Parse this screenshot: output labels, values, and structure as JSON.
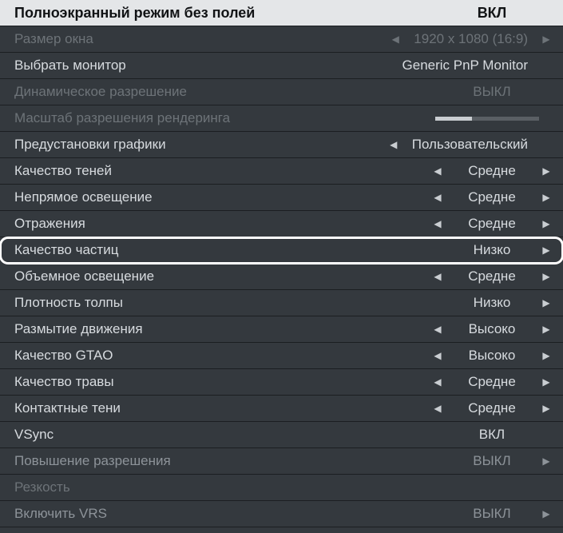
{
  "rows": [
    {
      "id": "borderless-fullscreen",
      "label": "Полноэкранный режим без полей",
      "value": "ВКЛ",
      "style": "header",
      "leftArrow": false,
      "rightArrow": false
    },
    {
      "id": "window-size",
      "label": "Размер окна",
      "value": "1920 x 1080 (16:9)",
      "style": "disabled",
      "leftArrow": true,
      "rightArrow": true
    },
    {
      "id": "select-monitor",
      "label": "Выбрать монитор",
      "value": "Generic PnP Monitor",
      "style": "normal",
      "leftArrow": false,
      "rightArrow": false
    },
    {
      "id": "dynamic-resolution",
      "label": "Динамическое разрешение",
      "value": "ВЫКЛ",
      "style": "disabled",
      "leftArrow": false,
      "rightArrow": false
    },
    {
      "id": "render-scale",
      "label": "Масштаб разрешения рендеринга",
      "value": "",
      "style": "disabled",
      "slider": true,
      "leftArrow": false,
      "rightArrow": false
    },
    {
      "id": "graphics-preset",
      "label": "Предустановки графики",
      "value": "Пользовательский",
      "style": "normal",
      "leftArrow": true,
      "rightArrow": false
    },
    {
      "id": "shadow-quality",
      "label": "Качество теней",
      "value": "Средне",
      "style": "normal",
      "leftArrow": true,
      "rightArrow": true
    },
    {
      "id": "indirect-lighting",
      "label": "Непрямое освещение",
      "value": "Средне",
      "style": "normal",
      "leftArrow": true,
      "rightArrow": true
    },
    {
      "id": "reflections",
      "label": "Отражения",
      "value": "Средне",
      "style": "normal",
      "leftArrow": true,
      "rightArrow": true
    },
    {
      "id": "particle-quality",
      "label": "Качество частиц",
      "value": "Низко",
      "style": "highlighted",
      "leftArrow": false,
      "rightArrow": true
    },
    {
      "id": "volumetric-lighting",
      "label": "Объемное освещение",
      "value": "Средне",
      "style": "normal",
      "leftArrow": true,
      "rightArrow": true
    },
    {
      "id": "crowd-density",
      "label": "Плотность толпы",
      "value": "Низко",
      "style": "normal",
      "leftArrow": false,
      "rightArrow": true
    },
    {
      "id": "motion-blur",
      "label": "Размытие движения",
      "value": "Высоко",
      "style": "normal",
      "leftArrow": true,
      "rightArrow": true
    },
    {
      "id": "gtao-quality",
      "label": "Качество GTAO",
      "value": "Высоко",
      "style": "normal",
      "leftArrow": true,
      "rightArrow": true
    },
    {
      "id": "grass-quality",
      "label": "Качество травы",
      "value": "Средне",
      "style": "normal",
      "leftArrow": true,
      "rightArrow": true
    },
    {
      "id": "contact-shadows",
      "label": "Контактные тени",
      "value": "Средне",
      "style": "normal",
      "leftArrow": true,
      "rightArrow": true
    },
    {
      "id": "vsync",
      "label": "VSync",
      "value": "ВКЛ",
      "style": "normal",
      "leftArrow": false,
      "rightArrow": false
    },
    {
      "id": "upscaling",
      "label": "Повышение разрешения",
      "value": "ВЫКЛ",
      "style": "faded",
      "leftArrow": false,
      "rightArrow": true
    },
    {
      "id": "sharpness",
      "label": "Резкость",
      "value": "",
      "style": "disabled",
      "leftArrow": false,
      "rightArrow": false
    },
    {
      "id": "enable-vrs",
      "label": "Включить VRS",
      "value": "ВЫКЛ",
      "style": "faded",
      "leftArrow": false,
      "rightArrow": true
    }
  ],
  "glyphs": {
    "left": "◀",
    "right": "▶"
  }
}
